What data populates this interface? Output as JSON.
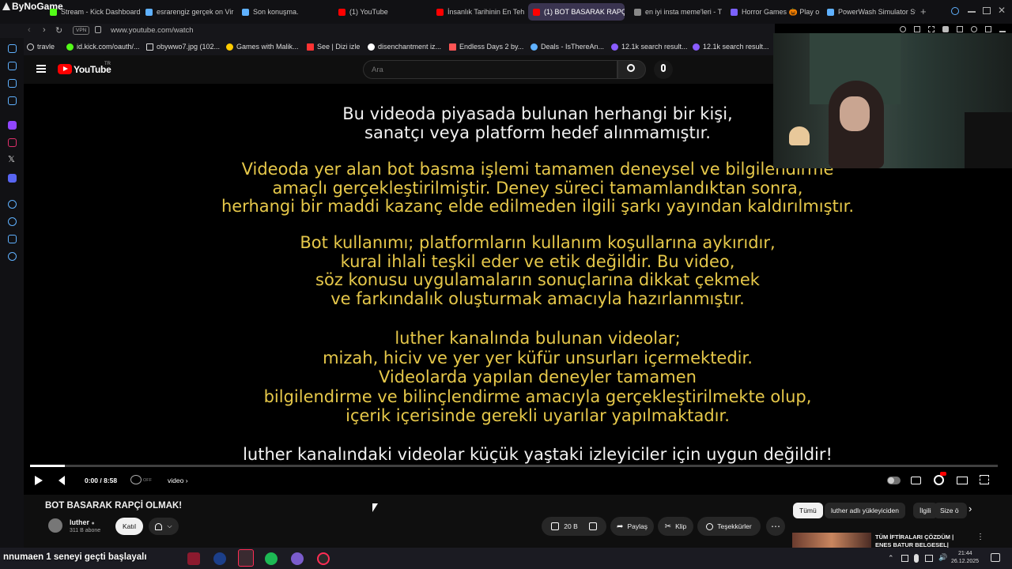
{
  "browser": {
    "brand": "ByNoGame",
    "tabs": [
      {
        "label": "Stream - Kick Dashboard",
        "color": "#53fc18"
      },
      {
        "label": "esrarengiz gerçek on Vir",
        "color": "#5fb1ff"
      },
      {
        "label": "Son konuşma.",
        "color": "#5fb1ff"
      },
      {
        "label": "(1) YouTube",
        "color": "#ff0000"
      },
      {
        "label": "İnsanlık Tarihinin En Teh",
        "color": "#ff0000"
      },
      {
        "label": "(1) BOT BASARAK RAPÇİ",
        "color": "#ff0000"
      },
      {
        "label": "en iyi insta meme'leri - T",
        "color": "#888888"
      },
      {
        "label": "Horror Games 🎃 Play o",
        "color": "#7b61ff"
      },
      {
        "label": "PowerWash Simulator Sto",
        "color": "#5fb1ff"
      }
    ],
    "vpn_label": "VPN",
    "url": "www.youtube.com/watch",
    "bookmarks": [
      {
        "label": "travle",
        "color": "#dddddd"
      },
      {
        "label": "id.kick.com/oauth/...",
        "color": "#53fc18"
      },
      {
        "label": "obywwo7.jpg (102...",
        "color": "#dddddd"
      },
      {
        "label": "Games with Malik...",
        "color": "#ffcc00"
      },
      {
        "label": "See | Dizi izle",
        "color": "#ff3333"
      },
      {
        "label": "disenchantment iz...",
        "color": "#ffffff"
      },
      {
        "label": "Endless Days 2 by...",
        "color": "#ff5555"
      },
      {
        "label": "Deals - IsThereAn...",
        "color": "#5fb1ff"
      },
      {
        "label": "12.1k search result...",
        "color": "#8a5cff"
      },
      {
        "label": "12.1k search result...",
        "color": "#8a5cff"
      }
    ]
  },
  "youtube": {
    "logo_text": "YouTube",
    "logo_region": "TR",
    "search_placeholder": "Ara"
  },
  "video_text": {
    "p1": [
      "Bu videoda piyasada bulunan herhangi bir kişi,",
      "sanatçı veya platform hedef alınmamıştır."
    ],
    "p2": [
      "Videoda yer alan bot basma işlemi tamamen deneysel ve bilgilendirme",
      "amaçlı gerçekleştirilmiştir. Deney süreci tamamlandıktan sonra,",
      "herhangi bir maddi kazanç elde edilmeden ilgili şarkı yayından kaldırılmıştır."
    ],
    "p3": [
      "Bot kullanımı; platformların kullanım koşullarına aykırıdır,",
      "kural ihlali teşkil eder ve etik değildir. Bu video,",
      "söz konusu uygulamaların sonuçlarına dikkat çekmek",
      "ve farkındalık oluşturmak amacıyla hazırlanmıştır."
    ],
    "p4": [
      "luther kanalında bulunan videolar;",
      "mizah, hiciv ve yer yer küfür unsurları içermektedir.",
      "Videolarda yapılan deneyler tamamen",
      "bilgilendirme ve bilinçlendirme amacıyla gerçekleştirilmekte olup,",
      "içerik içerisinde gerekli uyarılar yapılmaktadır."
    ],
    "p5": [
      "luther kanalındaki videolar küçük yaştaki izleyiciler için uygun değildir!"
    ]
  },
  "player": {
    "time": "0:00 / 8:58",
    "stable_volume": "OFF",
    "chapter": "video",
    "progress": 0.036
  },
  "watch": {
    "title": "BOT BASARAK RAPÇİ OLMAK!",
    "channel": "luther",
    "subscribers": "311 B abone",
    "join": "Katıl",
    "likes": "20 B",
    "share": "Paylaş",
    "clip": "Klip",
    "thanks": "Teşekkürler",
    "chips": [
      "Tümü",
      "luther adlı yükleyiciden",
      "İlgili",
      "Size ö"
    ],
    "rec_title_1": "TÜM İFTİRALARI ÇÖZDÜM |",
    "rec_title_2": "ENES BATUR BELGESEL|"
  },
  "taskbar": {
    "ticker": "nnumaen 1 seneyi geçti başlayalı",
    "time": "21:44",
    "date": "26.12.2025"
  }
}
